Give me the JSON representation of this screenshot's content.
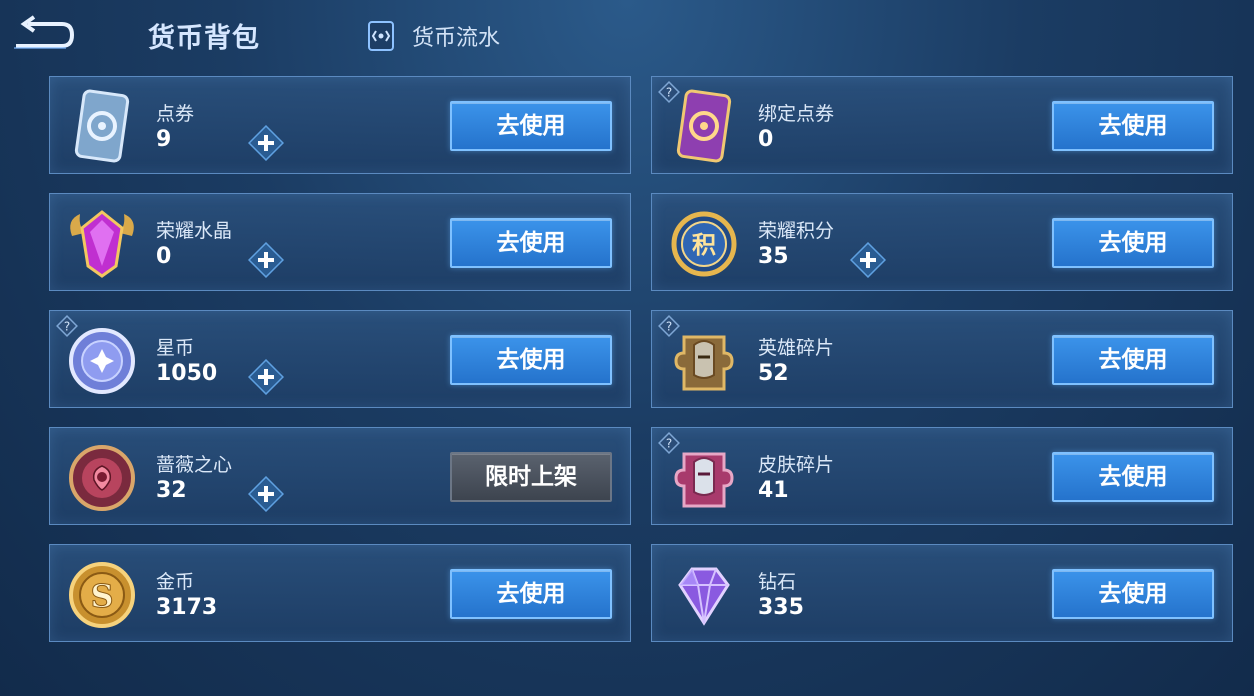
{
  "header": {
    "title": "货币背包",
    "flow_label": "货币流水"
  },
  "currencies": [
    {
      "name": "点券",
      "amount": "9",
      "button": "去使用",
      "icon": "coupon-card-icon"
    },
    {
      "name": "绑定点券",
      "amount": "0",
      "button": "去使用",
      "icon": "bound-coupon-card-icon"
    },
    {
      "name": "荣耀水晶",
      "amount": "0",
      "button": "去使用",
      "icon": "glory-crystal-icon"
    },
    {
      "name": "荣耀积分",
      "amount": "35",
      "button": "去使用",
      "icon": "glory-points-icon"
    },
    {
      "name": "星币",
      "amount": "1050",
      "button": "去使用",
      "icon": "star-coin-icon"
    },
    {
      "name": "英雄碎片",
      "amount": "52",
      "button": "去使用",
      "icon": "hero-fragment-icon"
    },
    {
      "name": "蔷薇之心",
      "amount": "32",
      "button": "限时上架",
      "icon": "rose-heart-icon"
    },
    {
      "name": "皮肤碎片",
      "amount": "41",
      "button": "去使用",
      "icon": "skin-fragment-icon"
    },
    {
      "name": "金币",
      "amount": "3173",
      "button": "去使用",
      "icon": "gold-coin-icon"
    },
    {
      "name": "钻石",
      "amount": "335",
      "button": "去使用",
      "icon": "diamond-icon"
    }
  ],
  "icon_glyphs": {
    "glory_points_badge": "积"
  },
  "colors": {
    "button_blue": "#2f86e0",
    "button_grey": "#4b535e",
    "card_border": "#5b8ac0",
    "background": "#1b3c63"
  }
}
